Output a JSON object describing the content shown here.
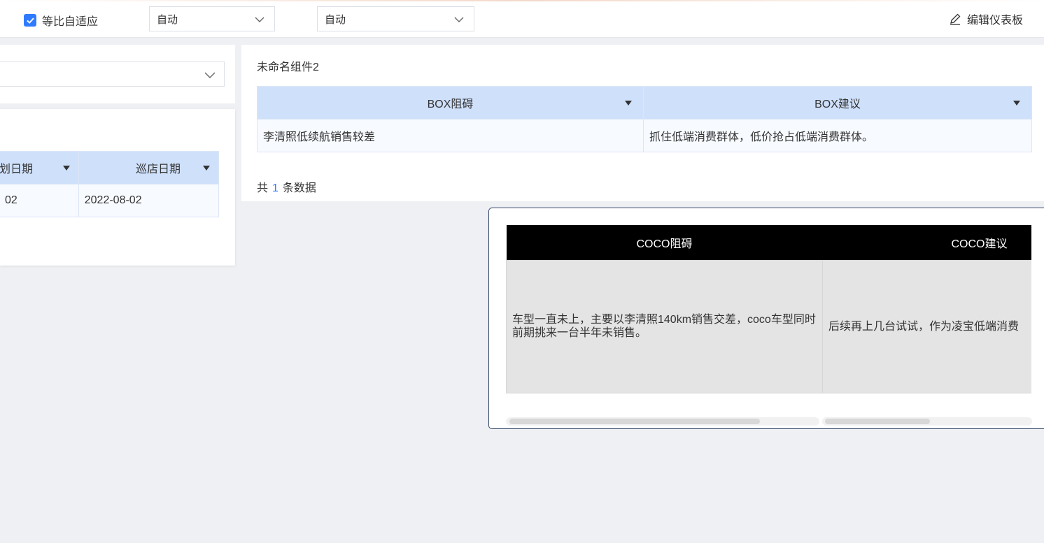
{
  "toolbar": {
    "checkbox_label": "等比自适应",
    "checkbox_checked": true,
    "select1_value": "自动",
    "select2_value": "自动",
    "edit_label": "编辑仪表板"
  },
  "left_table": {
    "headers": [
      "划日期",
      "巡店日期"
    ],
    "row": [
      "02",
      "2022-08-02"
    ]
  },
  "box_widget": {
    "title": "未命名组件2",
    "headers": [
      "BOX阻碍",
      "BOX建议"
    ],
    "row": [
      "李清照低续航销售较差",
      "抓住低端消费群体，低价抢占低端消费群体。"
    ],
    "count_prefix": "共",
    "count_value": "1",
    "count_suffix": "条数据"
  },
  "coco_widget": {
    "headers": [
      "COCO阻碍",
      "COCO建议"
    ],
    "row": [
      "车型一直未上，主要以李清照140km销售交差，coco车型同时前期挑来一台半年未销售。",
      "后续再上几台试试，作为凌宝低端消费"
    ]
  },
  "colors": {
    "accent": "#2f7bff",
    "table_header": "#cfe0fb",
    "coco_header": "#000000",
    "coco_cell": "#e4e4e4"
  }
}
